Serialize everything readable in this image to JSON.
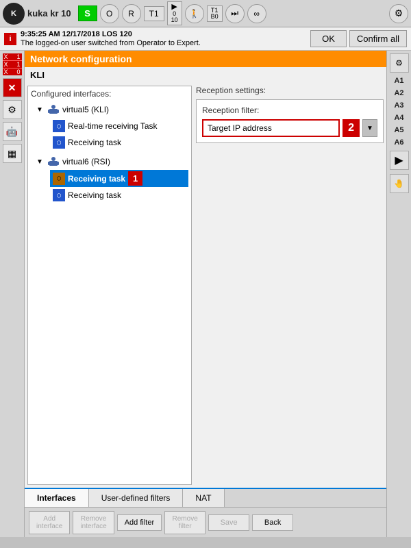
{
  "topbar": {
    "logo": "K",
    "title": "kuka kr 10",
    "btn_s": "S",
    "btn_o": "O",
    "btn_r": "R",
    "btn_t1": "T1",
    "play_count": "0",
    "play_sub": "10",
    "walk_icon": "🚶",
    "t1_b0": "T1\nB0",
    "skip_icon": "⏭",
    "infinity": "∞",
    "confirm_label": "Confirm all",
    "ok_label": "OK"
  },
  "notification": {
    "time": "9:35:25 AM 12/17/2018 LOS 120",
    "message": "The logged-on user switched from Operator to Expert.",
    "icon": "i",
    "ok": "OK",
    "confirm_all": "Confirm all"
  },
  "network": {
    "header": "Network configuration",
    "kli": "KLI",
    "configured_interfaces": "Configured interfaces:",
    "reception_settings": "Reception settings:",
    "reception_filter": "Reception filter:",
    "filter_value": "Target IP address",
    "filter_badge": "2",
    "interfaces_tab": "Interfaces",
    "user_defined_tab": "User-defined filters",
    "nat_tab": "NAT"
  },
  "tree": {
    "items": [
      {
        "label": "virtual5 (KLI)",
        "type": "parent",
        "indent": 1
      },
      {
        "label": "Real-time receiving Task",
        "type": "child",
        "indent": 2
      },
      {
        "label": "Receiving task",
        "type": "child",
        "indent": 2
      },
      {
        "label": "virtual6 (RSI)",
        "type": "parent",
        "indent": 1
      },
      {
        "label": "Receiving task",
        "type": "child",
        "indent": 2,
        "selected": true,
        "badge": "1"
      },
      {
        "label": "Receiving task",
        "type": "child",
        "indent": 2
      }
    ]
  },
  "toolbar": {
    "add_interface": "Add\ninterface",
    "remove_interface": "Remove\ninterface",
    "add_filter": "Add filter",
    "remove_filter": "Remove\nfilter",
    "save": "Save",
    "back": "Back"
  },
  "right_sidebar": {
    "labels": [
      "A1",
      "A2",
      "A3",
      "A4",
      "A5",
      "A6"
    ],
    "arrow_right": "▶",
    "hand_icon": "🤚"
  }
}
